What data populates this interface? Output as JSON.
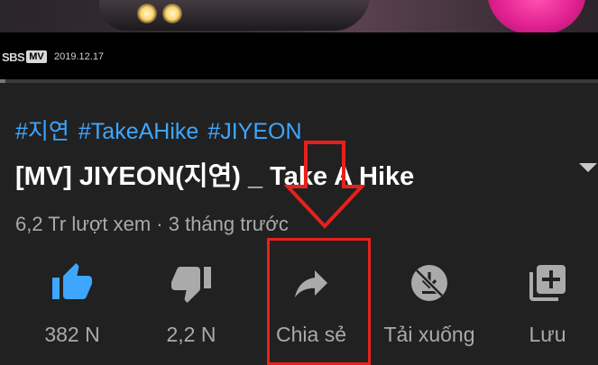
{
  "video": {
    "channel_logo": {
      "left": "SBS",
      "right": "MV"
    },
    "date": "2019.12.17"
  },
  "info": {
    "hashtags": [
      "#지연",
      "#TakeAHike",
      "#JIYEON"
    ],
    "title": "[MV] JIYEON(지연) _ Take A Hike",
    "meta": "6,2 Tr lượt xem · 3 tháng trước"
  },
  "actions": {
    "like": {
      "label": "382 N",
      "icon": "thumbs-up-icon"
    },
    "dislike": {
      "label": "2,2 N",
      "icon": "thumbs-down-icon"
    },
    "share": {
      "label": "Chia sẻ",
      "icon": "share-arrow-icon"
    },
    "download": {
      "label": "Tải xuống",
      "icon": "download-off-icon"
    },
    "save": {
      "label": "Lưu",
      "icon": "playlist-add-icon"
    }
  },
  "colors": {
    "background": "#212121",
    "hashtag": "#3ea6ff",
    "like_active": "#3ea6ff",
    "secondary_text": "#aaaaaa",
    "annotation_red": "#e8201c"
  }
}
